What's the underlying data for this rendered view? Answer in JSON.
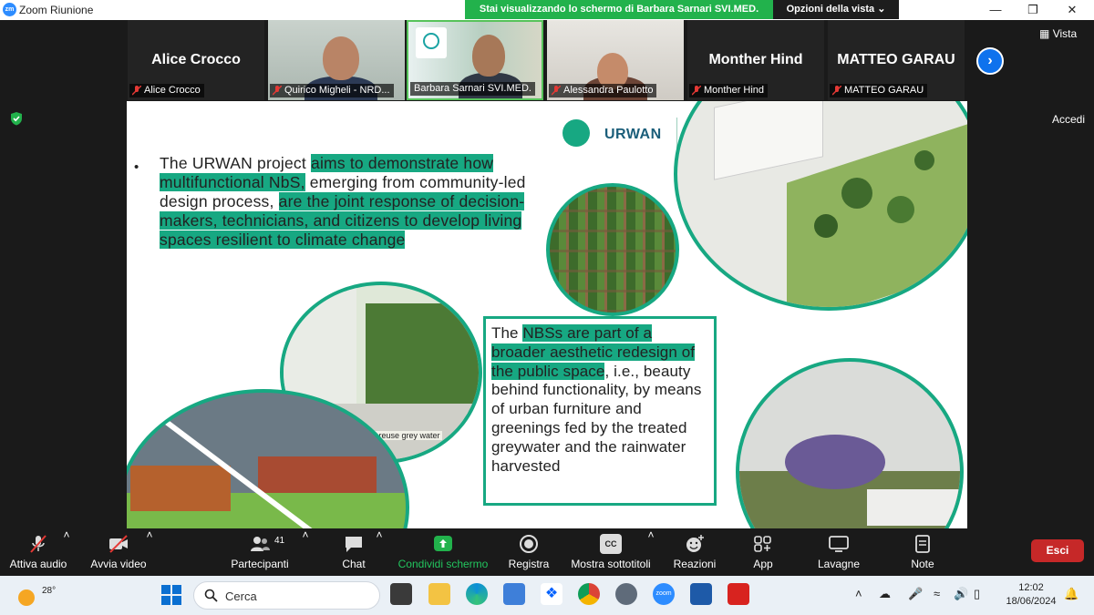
{
  "app": {
    "title": "Zoom Riunione"
  },
  "share_banner": {
    "message": "Stai visualizzando lo schermo di Barbara Sarnari SVI.MED.",
    "view_options": "Opzioni della vista"
  },
  "strip": {
    "vista_label": "Vista",
    "accedi_label": "Accedi",
    "participants": [
      {
        "display_name": "Alice Crocco",
        "label": "Alice Crocco",
        "video": false
      },
      {
        "display_name": "",
        "label": "Quirico Migheli - NRD...",
        "video": true
      },
      {
        "display_name": "",
        "label": "Barbara Sarnari SVI.MED.",
        "video": true,
        "active_speaker": true
      },
      {
        "display_name": "",
        "label": "Alessandra Paulotto",
        "video": true
      },
      {
        "display_name": "Monther Hind",
        "label": "Monther Hind",
        "video": false
      },
      {
        "display_name": "MATTEO GARAU",
        "label": "MATTEO GARAU",
        "video": false
      }
    ]
  },
  "slide": {
    "logo_text": "URWAN",
    "bullet": {
      "parts": [
        {
          "text": "The URWAN project ",
          "highlight": false
        },
        {
          "text": "aims to demonstrate how multifunctional NbS,",
          "highlight": true
        },
        {
          "text": " emerging from community-led design process, ",
          "highlight": false
        },
        {
          "text": "are the joint response of decision-makers, technicians, and citizens to develop living spaces resilient to climate change",
          "highlight": true
        }
      ]
    },
    "box": {
      "parts": [
        {
          "text": "The ",
          "highlight": false
        },
        {
          "text": "NBSs are part of a broader aesthetic redesign of the public space",
          "highlight": true
        },
        {
          "text": ", i.e., beauty behind functionality, by means of urban furniture and greenings fed by the treated greywater and the rainwater harvested",
          "highlight": false
        }
      ]
    },
    "image_caption": "nd reuse grey water",
    "accent_color": "#17a882"
  },
  "toolbar": {
    "audio": "Attiva audio",
    "video": "Avvia video",
    "participants": "Partecipanti",
    "participants_count": "41",
    "chat": "Chat",
    "share": "Condividi schermo",
    "record": "Registra",
    "captions": "Mostra sottotitoli",
    "captions_icon_text": "CC",
    "reactions": "Reazioni",
    "apps": "App",
    "whiteboards": "Lavagne",
    "notes": "Note",
    "leave": "Esci"
  },
  "taskbar": {
    "temperature": "28°",
    "search_placeholder": "Cerca",
    "zoom_icon_text": "zoom",
    "time": "12:02",
    "date": "18/06/2024"
  }
}
